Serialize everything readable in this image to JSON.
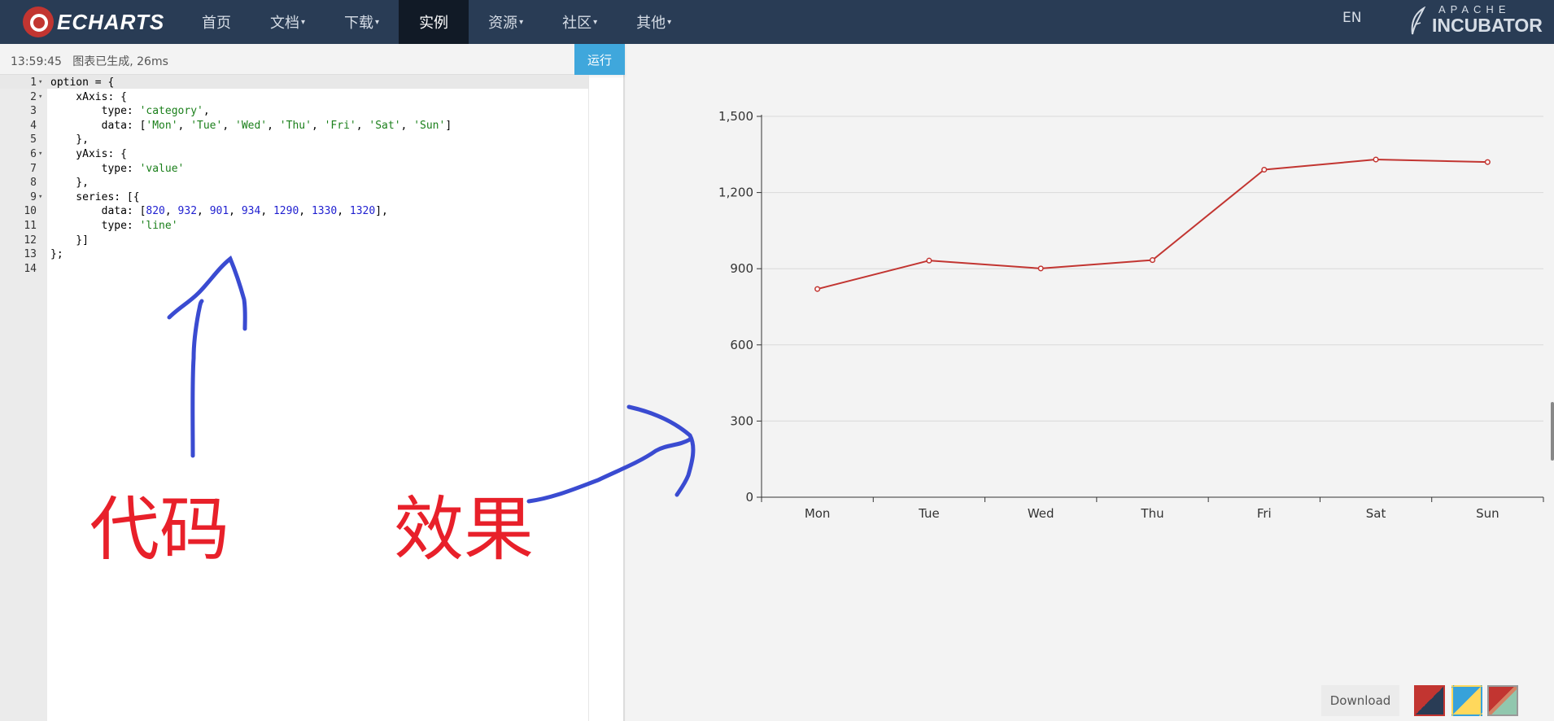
{
  "nav": {
    "logo": "ECHARTS",
    "items": [
      {
        "label": "首页",
        "caret": ""
      },
      {
        "label": "文档",
        "caret": "▾"
      },
      {
        "label": "下载",
        "caret": "▾"
      },
      {
        "label": "实例",
        "caret": ""
      },
      {
        "label": "资源",
        "caret": "▾"
      },
      {
        "label": "社区",
        "caret": "▾"
      },
      {
        "label": "其他",
        "caret": "▾"
      }
    ],
    "active_item": "实例",
    "lang": "EN",
    "incubator_top": "APACHE",
    "incubator_bottom": "INCUBATOR"
  },
  "editor": {
    "status_time": "13:59:45",
    "status_message": "图表已生成, 26ms",
    "run_label": "运行",
    "lines": [
      {
        "n": "1",
        "fold": "▾",
        "code": "option = {"
      },
      {
        "n": "2",
        "fold": "▾",
        "code": "    xAxis: {"
      },
      {
        "n": "3",
        "fold": "",
        "code": "        type: 'category',"
      },
      {
        "n": "4",
        "fold": "",
        "code": "        data: ['Mon', 'Tue', 'Wed', 'Thu', 'Fri', 'Sat', 'Sun']"
      },
      {
        "n": "5",
        "fold": "",
        "code": "    },"
      },
      {
        "n": "6",
        "fold": "▾",
        "code": "    yAxis: {"
      },
      {
        "n": "7",
        "fold": "",
        "code": "        type: 'value'"
      },
      {
        "n": "8",
        "fold": "",
        "code": "    },"
      },
      {
        "n": "9",
        "fold": "▾",
        "code": "    series: [{"
      },
      {
        "n": "10",
        "fold": "",
        "code": "        data: [820, 932, 901, 934, 1290, 1330, 1320],"
      },
      {
        "n": "11",
        "fold": "",
        "code": "        type: 'line'"
      },
      {
        "n": "12",
        "fold": "",
        "code": "    }]"
      },
      {
        "n": "13",
        "fold": "",
        "code": "};"
      },
      {
        "n": "14",
        "fold": "",
        "code": ""
      }
    ]
  },
  "annotations": {
    "code_label": "代码",
    "effect_label": "效果",
    "color": "#e8202a",
    "arrow_color": "#3a4bd1"
  },
  "chart_data": {
    "type": "line",
    "categories": [
      "Mon",
      "Tue",
      "Wed",
      "Thu",
      "Fri",
      "Sat",
      "Sun"
    ],
    "values": [
      820,
      932,
      901,
      934,
      1290,
      1330,
      1320
    ],
    "title": "",
    "xlabel": "",
    "ylabel": "",
    "ylim": [
      0,
      1500
    ],
    "yticks": [
      0,
      300,
      600,
      900,
      1200,
      1500
    ],
    "ytick_labels": [
      "0",
      "300",
      "600",
      "900",
      "1,200",
      "1,500"
    ],
    "grid": true,
    "line_color": "#c23531"
  },
  "chart_footer": {
    "download_label": "Download",
    "themes": [
      "dark",
      "light",
      "default"
    ],
    "selected_theme": "dark"
  }
}
